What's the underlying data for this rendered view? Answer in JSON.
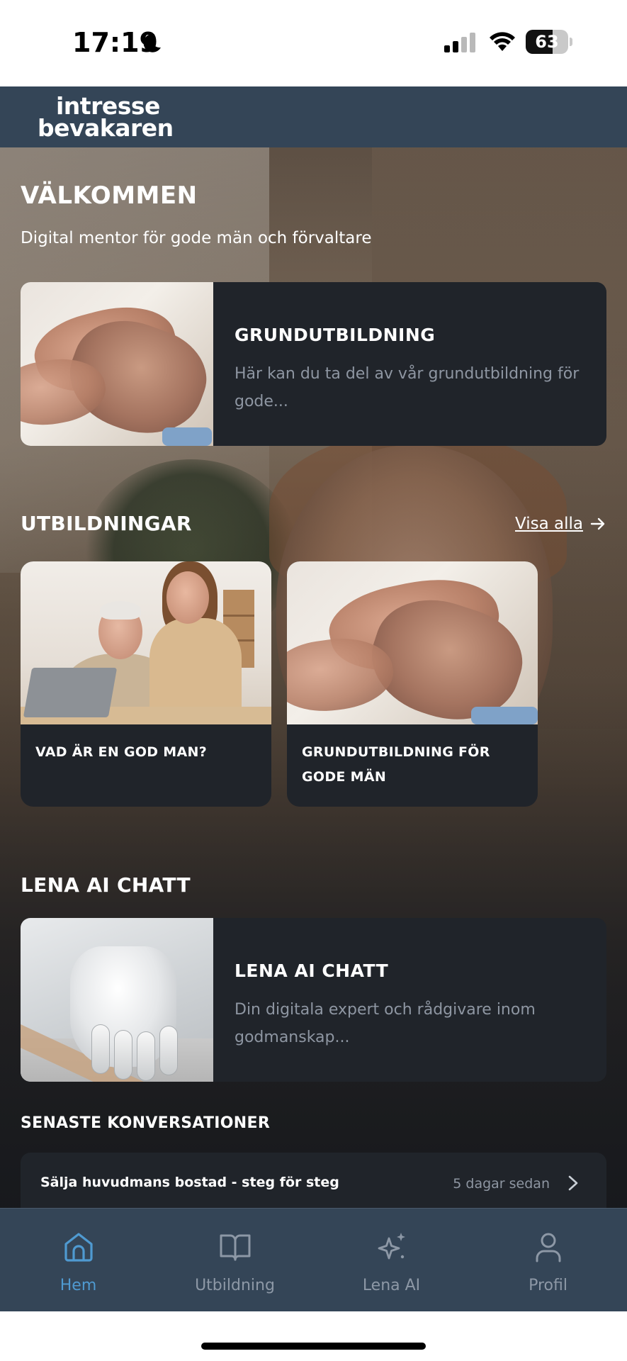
{
  "status_bar": {
    "time": "17:19",
    "battery_level": "63",
    "battery_fraction": 0.63
  },
  "header": {
    "logo_line1": "intresse",
    "logo_line2": "bevakaren"
  },
  "welcome": {
    "title": "VÄLKOMMEN",
    "subtitle": "Digital mentor för gode män och förvaltare"
  },
  "featured_course": {
    "title": "GRUNDUTBILDNING",
    "description": "Här kan du ta del av vår grundutbildning för gode..."
  },
  "courses": {
    "section_title": "UTBILDNINGAR",
    "see_all_label": "Visa alla",
    "items": [
      {
        "title": "VAD ÄR EN GOD MAN?"
      },
      {
        "title": "GRUNDUTBILDNING FÖR GODE MÄN"
      }
    ]
  },
  "ai_chat": {
    "section_title": "LENA AI CHATT",
    "card_title": "LENA AI CHATT",
    "card_description": "Din digitala expert och rådgivare inom godmanskap..."
  },
  "conversations": {
    "section_title": "SENASTE KONVERSATIONER",
    "items": [
      {
        "title": "Sälja huvudmans bostad - steg för steg",
        "time": "5 dagar sedan"
      }
    ]
  },
  "tab_bar": {
    "active": "Hem",
    "active_color": "#4f9ad1",
    "tabs": [
      {
        "label": "Hem",
        "icon": "home-icon"
      },
      {
        "label": "Utbildning",
        "icon": "book-icon"
      },
      {
        "label": "Lena AI",
        "icon": "sparkle-icon"
      },
      {
        "label": "Profil",
        "icon": "user-icon"
      }
    ]
  },
  "colors": {
    "header_bg": "#344557",
    "card_bg": "#20242a",
    "muted_text": "#8e96a2"
  }
}
